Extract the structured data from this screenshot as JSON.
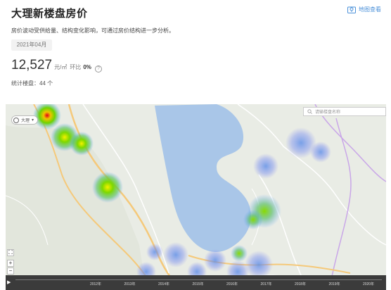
{
  "header": {
    "title": "大理新楼盘房价",
    "map_link": "地图查看",
    "description": "房价波动受供给量、结构变化影响，可通过房价结构进一步分析。",
    "date": "2021年04月",
    "price": "12,527",
    "unit": "元/㎡",
    "change_label": "环比",
    "change_value": "0%",
    "help": "?",
    "count_label": "统计楼盘：",
    "count_value": "44 个"
  },
  "map": {
    "select_label": "大理",
    "search_placeholder": "请输楼盘名称",
    "fullscreen": "⛶",
    "zoom_in": "+",
    "zoom_out": "−",
    "play": "▶",
    "timeline_years": [
      "2012年",
      "2013年",
      "2014年",
      "2015年",
      "2016年",
      "2017年",
      "2018年",
      "2019年",
      "2020年"
    ]
  },
  "colors": {
    "accent": "#4a90d9",
    "lake": "#a9c6e8",
    "timeline_bg": "#3b3b3b"
  },
  "icons": {
    "map_link": "map-icon",
    "search": "search-icon",
    "help": "help-icon",
    "play": "play-icon"
  }
}
